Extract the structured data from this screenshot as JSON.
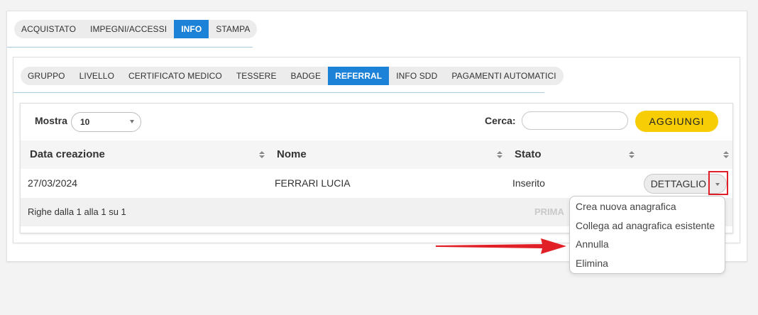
{
  "top_tabs": [
    {
      "label": "ACQUISTATO",
      "active": false
    },
    {
      "label": "IMPEGNI/ACCESSI",
      "active": false
    },
    {
      "label": "INFO",
      "active": true
    },
    {
      "label": "STAMPA",
      "active": false
    }
  ],
  "sub_tabs": [
    {
      "label": "GRUPPO",
      "active": false
    },
    {
      "label": "LIVELLO",
      "active": false
    },
    {
      "label": "CERTIFICATO MEDICO",
      "active": false
    },
    {
      "label": "TESSERE",
      "active": false
    },
    {
      "label": "BADGE",
      "active": false
    },
    {
      "label": "REFERRAL",
      "active": true
    },
    {
      "label": "INFO SDD",
      "active": false
    },
    {
      "label": "PAGAMENTI AUTOMATICI",
      "active": false
    }
  ],
  "toolbar": {
    "show_label": "Mostra",
    "show_value": "10",
    "search_label": "Cerca:",
    "search_value": "",
    "add_label": "AGGIUNGI"
  },
  "table": {
    "columns": [
      "Data creazione",
      "Nome",
      "Stato",
      ""
    ],
    "rows": [
      {
        "date": "27/03/2024",
        "name": "FERRARI LUCIA",
        "status": "Inserito",
        "action": "DETTAGLIO"
      }
    ],
    "footer_info": "Righe dalla 1 alla 1 su 1",
    "first_label": "PRIMA"
  },
  "dropdown_menu": {
    "items": [
      "Crea nuova anagrafica",
      "Collega ad anagrafica esistente",
      "Annulla",
      "Elimina"
    ]
  },
  "colors": {
    "accent_blue": "#1b82d8",
    "button_yellow": "#f7cd06",
    "highlight_red": "#e01f26"
  },
  "icons": [
    "chevron-down-icon",
    "sort-icon",
    "arrow-icon"
  ]
}
